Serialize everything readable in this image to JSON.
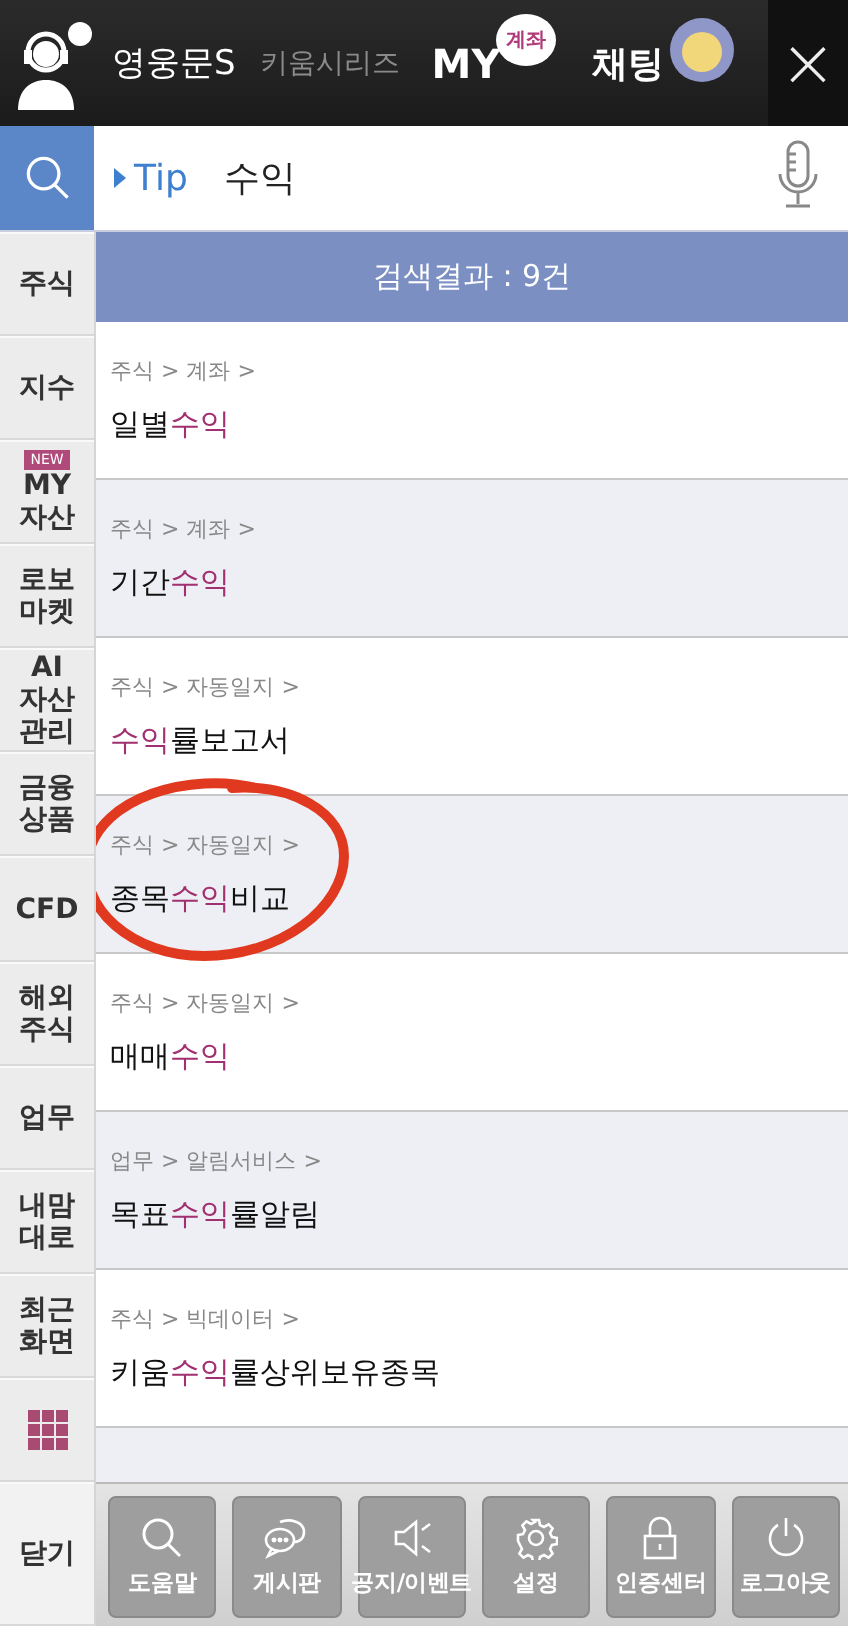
{
  "header": {
    "app_name": "영웅문S",
    "series_link": "키움시리즈",
    "my_label": "MY",
    "my_bubble": "계좌",
    "chat_label": "채팅",
    "close": "×"
  },
  "search": {
    "tip": "Tip",
    "value": "수익"
  },
  "sidebar": {
    "items": [
      {
        "label": "주식",
        "kind": "text"
      },
      {
        "label": "지수",
        "kind": "text"
      },
      {
        "label": "MY 자산",
        "kind": "text",
        "badge": "NEW"
      },
      {
        "label": "로보 마켓",
        "kind": "text"
      },
      {
        "label": "AI 자산 관리",
        "kind": "text"
      },
      {
        "label": "금융 상품",
        "kind": "text"
      },
      {
        "label": "CFD",
        "kind": "text"
      },
      {
        "label": "해외 주식",
        "kind": "text"
      },
      {
        "label": "업무",
        "kind": "text"
      },
      {
        "label": "내맘 대로",
        "kind": "text"
      },
      {
        "label": "최근 화면",
        "kind": "text"
      },
      {
        "kind": "grid"
      },
      {
        "label": "닫기",
        "kind": "close"
      }
    ]
  },
  "results": {
    "summary": "검색결과 : 9건",
    "rows": [
      {
        "path": "주식 > 계좌 >",
        "title_parts": [
          {
            "text": "일별",
            "match": false
          },
          {
            "text": "수익",
            "match": true
          }
        ],
        "circled": false
      },
      {
        "path": "주식 > 계좌 >",
        "title_parts": [
          {
            "text": "기간",
            "match": false
          },
          {
            "text": "수익",
            "match": true
          }
        ],
        "circled": false
      },
      {
        "path": "주식 > 자동일지 >",
        "title_parts": [
          {
            "text": "수익",
            "match": true
          },
          {
            "text": "률보고서",
            "match": false
          }
        ],
        "circled": false
      },
      {
        "path": "주식 > 자동일지 >",
        "title_parts": [
          {
            "text": "종목",
            "match": false
          },
          {
            "text": "수익",
            "match": true
          },
          {
            "text": "비교",
            "match": false
          }
        ],
        "circled": true
      },
      {
        "path": "주식 > 자동일지 >",
        "title_parts": [
          {
            "text": "매매",
            "match": false
          },
          {
            "text": "수익",
            "match": true
          }
        ],
        "circled": false
      },
      {
        "path": "업무 > 알림서비스 >",
        "title_parts": [
          {
            "text": "목표",
            "match": false
          },
          {
            "text": "수익",
            "match": true
          },
          {
            "text": "률알림",
            "match": false
          }
        ],
        "circled": false
      },
      {
        "path": "주식 > 빅데이터 >",
        "title_parts": [
          {
            "text": "키움",
            "match": false
          },
          {
            "text": "수익",
            "match": true
          },
          {
            "text": "률상위보유종목",
            "match": false
          }
        ],
        "circled": false
      }
    ]
  },
  "toolbar": [
    {
      "label": "도움말"
    },
    {
      "label": "게시판"
    },
    {
      "label": "공지/이벤트"
    },
    {
      "label": "설정"
    },
    {
      "label": "인증센터"
    },
    {
      "label": "로그아웃"
    }
  ]
}
